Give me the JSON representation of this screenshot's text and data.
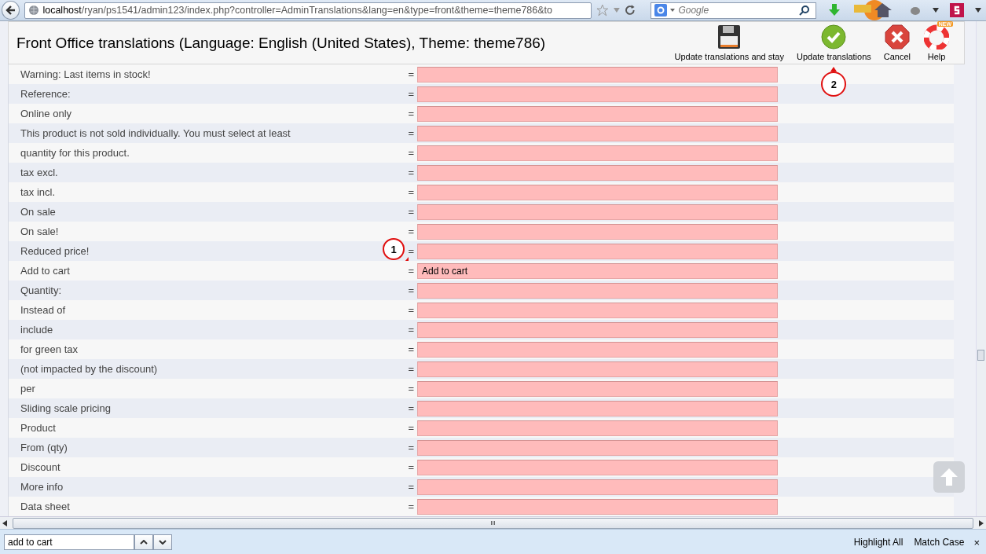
{
  "browser": {
    "url_host": "localhost",
    "url_path": "/ryan/ps1541/admin123/index.php?controller=AdminTranslations&lang=en&type=front&theme=theme786&to",
    "search_placeholder": "Google"
  },
  "header": {
    "title": "Front Office translations (Language: English (United States), Theme: theme786)",
    "buttons": [
      {
        "kind": "save",
        "label": "Update translations and stay"
      },
      {
        "kind": "check",
        "label": "Update translations",
        "callout": "2"
      },
      {
        "kind": "cancel",
        "label": "Cancel"
      },
      {
        "kind": "help",
        "label": "Help",
        "badge": "NEW"
      }
    ]
  },
  "rows": [
    {
      "label": "Warning: Last items in stock!",
      "sep": "="
    },
    {
      "label": "Reference:",
      "sep": "="
    },
    {
      "label": "Online only",
      "sep": "="
    },
    {
      "label": "This product is not sold individually. You must select at least",
      "sep": "="
    },
    {
      "label": "quantity for this product.",
      "sep": "="
    },
    {
      "label": "tax excl.",
      "sep": "="
    },
    {
      "label": "tax incl.",
      "sep": "="
    },
    {
      "label": "On sale",
      "sep": "="
    },
    {
      "label": "On sale!",
      "sep": "="
    },
    {
      "label": "Reduced price!",
      "sep": "=",
      "callout": "1"
    },
    {
      "label": "Add to cart",
      "sep": "=",
      "value": "Add to cart"
    },
    {
      "label": "Quantity:",
      "sep": "="
    },
    {
      "label": "Instead of",
      "sep": "="
    },
    {
      "label": "include",
      "sep": "="
    },
    {
      "label": "for green tax",
      "sep": "="
    },
    {
      "label": "(not impacted by the discount)",
      "sep": "="
    },
    {
      "label": "per",
      "sep": "="
    },
    {
      "label": "Sliding scale pricing",
      "sep": "="
    },
    {
      "label": "Product",
      "sep": "="
    },
    {
      "label": "From (qty)",
      "sep": "="
    },
    {
      "label": "Discount",
      "sep": "="
    },
    {
      "label": "More info",
      "sep": "="
    },
    {
      "label": "Data sheet",
      "sep": "="
    }
  ],
  "scroll_grip": "III",
  "find_bar": {
    "value": "add to cart",
    "options": [
      "Highlight All",
      "Match Case"
    ],
    "close": "×"
  }
}
